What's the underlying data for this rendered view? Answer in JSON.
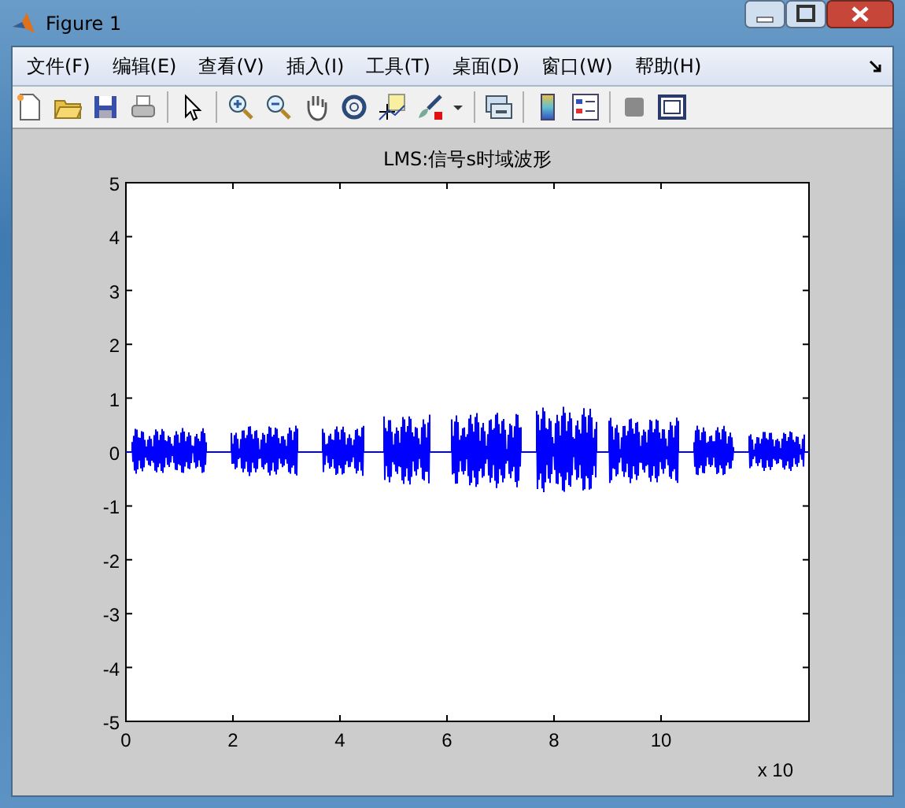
{
  "window": {
    "title": "Figure 1"
  },
  "menu": [
    "文件(F)",
    "编辑(E)",
    "查看(V)",
    "插入(I)",
    "工具(T)",
    "桌面(D)",
    "窗口(W)",
    "帮助(H)"
  ],
  "axes": {
    "title": "LMS:信号s时域波形",
    "yticks": [
      "5",
      "4",
      "3",
      "2",
      "1",
      "0",
      "-1",
      "-2",
      "-3",
      "-4",
      "-5"
    ],
    "xticks": [
      "0",
      "2",
      "4",
      "6",
      "8",
      "10"
    ],
    "x_multiplier": "x 10"
  }
}
